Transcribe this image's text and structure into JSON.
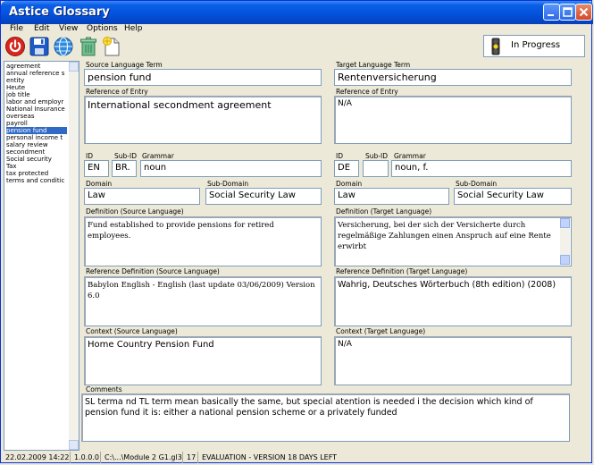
{
  "window": {
    "title": "Astice Glossary"
  },
  "menu": [
    "File",
    "Edit",
    "View",
    "Options",
    "Help"
  ],
  "toolbar": {
    "status": "In Progress"
  },
  "terms": [
    "agreement",
    "annual reference s",
    "entity",
    "Heute",
    "job title",
    "labor and employr",
    "National Insurance",
    "overseas",
    "payroll",
    "pension fund",
    "personal income t",
    "salary review",
    "secondment",
    "Social security",
    "Tax",
    "tax protected",
    "terms and conditic"
  ],
  "selected_term": "pension fund",
  "source": {
    "term_label": "Source Language Term",
    "term": "pension fund",
    "ref_entry_label": "Reference of Entry",
    "ref_entry": "International secondment agreement",
    "id_label": "ID",
    "id": "EN",
    "subid_label": "Sub-ID",
    "subid": "BR.",
    "grammar_label": "Grammar",
    "grammar": "noun",
    "domain_label": "Domain",
    "domain": "Law",
    "subdomain_label": "Sub-Domain",
    "subdomain": "Social Security Law",
    "def_label": "Definition (Source Language)",
    "definition": "Fund established to provide pensions for retired employees.",
    "refdef_label": "Reference Definition (Source Language)",
    "refdef": "Babylon English - English (last update 03/06/2009) Version 6.0",
    "context_label": "Context (Source Language)",
    "context": "Home Country Pension Fund"
  },
  "target": {
    "term_label": "Target Language Term",
    "term": "Rentenversicherung",
    "ref_entry_label": "Reference of Entry",
    "ref_entry": "N/A",
    "id_label": "ID",
    "id": "DE",
    "subid_label": "Sub-ID",
    "subid": "",
    "grammar_label": "Grammar",
    "grammar": "noun, f.",
    "domain_label": "Domain",
    "domain": "Law",
    "subdomain_label": "Sub-Domain",
    "subdomain": "Social Security Law",
    "def_label": "Definition (Target Language)",
    "definition": "Versicherung, bei der sich der Versicherte durch regelmäßige Zahlungen einen Anspruch auf eine Rente erwirbt",
    "refdef_label": "Reference Definition (Target Language)",
    "refdef": "Wahrig, Deutsches Wörterbuch (8th edition) (2008)",
    "context_label": "Context (Target Language)",
    "context": "N/A"
  },
  "comments": {
    "label": "Comments",
    "text": "SL terma nd TL term mean basically the same, but special atention is needed i the decision which kind of pension fund it is: either a national pension scheme or a privately funded"
  },
  "statusbar": {
    "datetime": "22.02.2009 14:22",
    "version": "1.0.0.0",
    "file": "C:\\...\\Module 2 G1.gl3",
    "count": "17",
    "license": "EVALUATION - VERSION   18 DAYS LEFT"
  },
  "colors": {
    "titlebar": "#0454E0",
    "selection": "#316AC5",
    "window_bg": "#ECE9D8"
  }
}
